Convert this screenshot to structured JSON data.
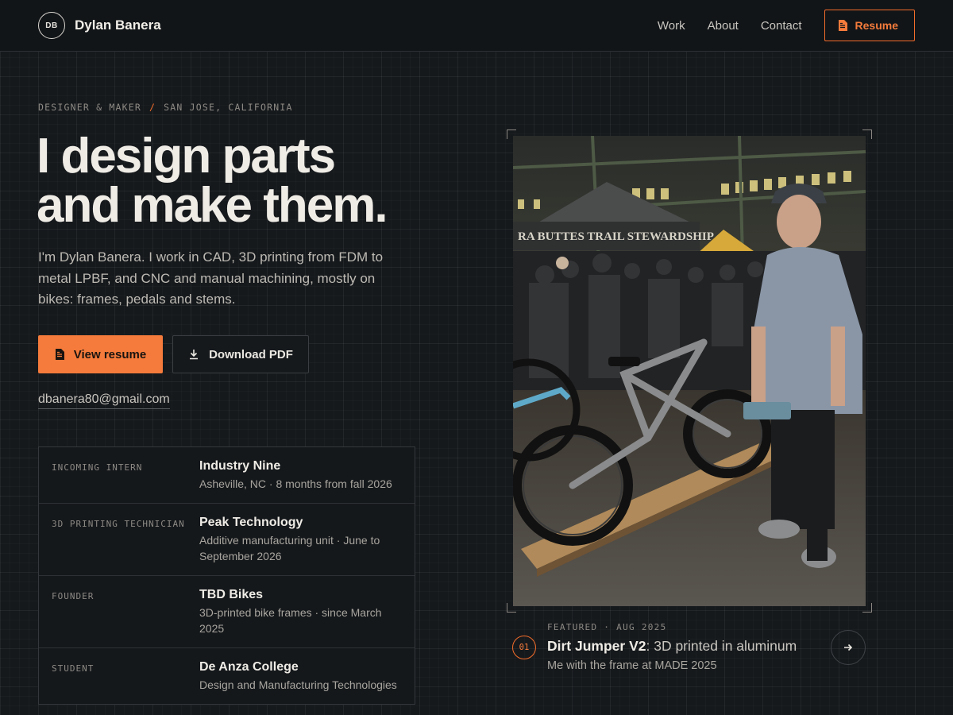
{
  "header": {
    "logo_initials": "DB",
    "name": "Dylan Banera",
    "nav": [
      {
        "label": "Work"
      },
      {
        "label": "About"
      },
      {
        "label": "Contact"
      }
    ],
    "resume_label": "Resume"
  },
  "hero": {
    "eyebrow_left": "DESIGNER & MAKER",
    "eyebrow_sep": "/",
    "eyebrow_right": "SAN JOSE, CALIFORNIA",
    "headline_line1": "I design parts",
    "headline_line2": "and make them.",
    "intro": "I'm Dylan Banera. I work in CAD, 3D printing from FDM to metal LPBF, and CNC and manual machining, mostly on bikes: frames, pedals and stems.",
    "primary_cta": "View resume",
    "secondary_cta": "Download PDF",
    "email": "dbanera80@gmail.com"
  },
  "experience": [
    {
      "role": "INCOMING INTERN",
      "org": "Industry Nine",
      "detail": "Asheville, NC · 8 months from fall 2026"
    },
    {
      "role": "3D PRINTING TECHNICIAN",
      "org": "Peak Technology",
      "detail": "Additive manufacturing unit · June to September 2026"
    },
    {
      "role": "FOUNDER",
      "org": "TBD Bikes",
      "detail": "3D-printed bike frames · since March 2025"
    },
    {
      "role": "STUDENT",
      "org": "De Anza College",
      "detail": "Design and Manufacturing Technologies"
    }
  ],
  "featured": {
    "number": "01",
    "meta": "FEATURED · AUG 2025",
    "title_bold": "Dirt Jumper V2",
    "title_rest": ": 3D printed in aluminum",
    "subtitle": "Me with the frame at MADE 2025",
    "photo_banner": "RA BUTTES TRAIL STEWARDSHIP"
  },
  "colors": {
    "accent": "#f47b3b",
    "background": "#16191c",
    "header": "#121518"
  }
}
